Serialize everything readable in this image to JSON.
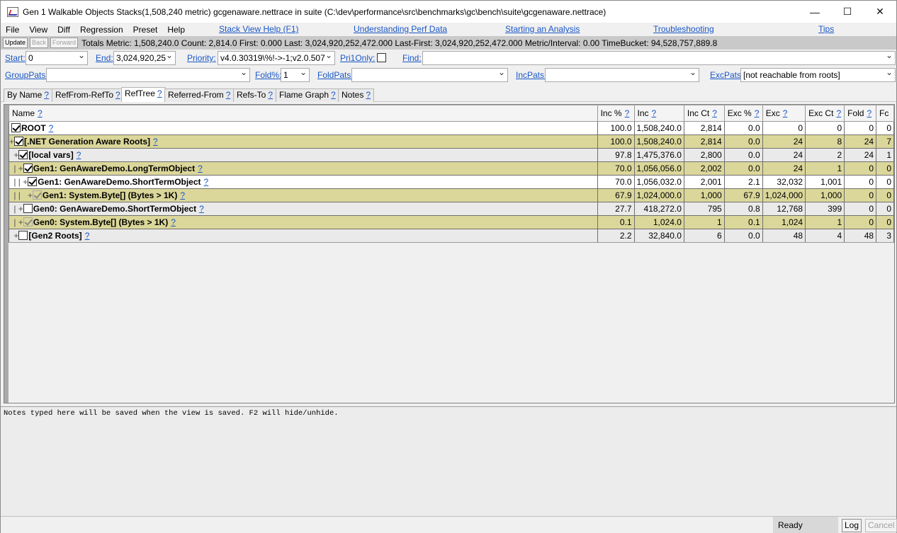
{
  "window": {
    "title": "Gen 1 Walkable Objects Stacks(1,508,240 metric) gcgenaware.nettrace in suite (C:\\dev\\performance\\src\\benchmarks\\gc\\bench\\suite\\gcgenaware.nettrace)",
    "minimize": "—",
    "maximize": "☐",
    "close": "✕"
  },
  "menu": {
    "items": [
      "File",
      "View",
      "Diff",
      "Regression",
      "Preset",
      "Help"
    ],
    "links": [
      "Stack View Help (F1)",
      "Understanding Perf Data",
      "Starting an Analysis",
      "Troubleshooting",
      "Tips"
    ]
  },
  "status": {
    "update": "Update",
    "back": "Back",
    "forward": "Forward",
    "totals": "Totals Metric: 1,508,240.0  Count: 2,814.0  First: 0.000 Last: 3,024,920,252,472.000  Last-First: 3,024,920,252,472.000  Metric/Interval: 0.00  TimeBucket: 94,528,757,889.8"
  },
  "filters": {
    "start_label": "Start:",
    "start_value": "0",
    "end_label": "End:",
    "end_value": "3,024,920,25",
    "priority_label": "Priority:",
    "priority_value": "v4.0.30319\\%!->-1;v2.0.507",
    "pri1only_label": "Pri1Only:",
    "find_label": "Find:",
    "find_value": "",
    "grouppats_label": "GroupPats:",
    "grouppats_value": "",
    "fold_label": "Fold%:",
    "fold_value": "1",
    "foldpats_label": "FoldPats:",
    "foldpats_value": "",
    "incpats_label": "IncPats:",
    "incpats_value": "",
    "excpats_label": "ExcPats:",
    "excpats_value": "[not reachable from roots]"
  },
  "tabs": [
    {
      "label": "By Name"
    },
    {
      "label": "RefFrom-RefTo"
    },
    {
      "label": "RefTree"
    },
    {
      "label": "Referred-From"
    },
    {
      "label": "Refs-To"
    },
    {
      "label": "Flame Graph"
    },
    {
      "label": "Notes"
    }
  ],
  "help_mark": "?",
  "columns": [
    "Name",
    "Inc %",
    "Inc",
    "Inc Ct",
    "Exc %",
    "Exc",
    "Exc Ct",
    "Fold",
    "Fc"
  ],
  "rows": [
    {
      "prefix": "",
      "name": "ROOT",
      "inc_pct": "100.0",
      "inc": "1,508,240.0",
      "inc_ct": "2,814",
      "exc_pct": "0.0",
      "exc": "0",
      "exc_ct": "0",
      "fold": "0",
      "fc": "0"
    },
    {
      "prefix": "+",
      "name": "[.NET Generation Aware Roots]",
      "inc_pct": "100.0",
      "inc": "1,508,240.0",
      "inc_ct": "2,814",
      "exc_pct": "0.0",
      "exc": "24",
      "exc_ct": "8",
      "fold": "24",
      "fc": "7"
    },
    {
      "prefix": " +",
      "name": "[local vars]",
      "inc_pct": "97.8",
      "inc": "1,475,376.0",
      "inc_ct": "2,800",
      "exc_pct": "0.0",
      "exc": "24",
      "exc_ct": "2",
      "fold": "24",
      "fc": "1"
    },
    {
      "prefix": " | +",
      "name": "Gen1: GenAwareDemo.LongTermObject",
      "inc_pct": "70.0",
      "inc": "1,056,056.0",
      "inc_ct": "2,002",
      "exc_pct": "0.0",
      "exc": "24",
      "exc_ct": "1",
      "fold": "0",
      "fc": "0"
    },
    {
      "prefix": " | | +",
      "name": "Gen1: GenAwareDemo.ShortTermObject",
      "inc_pct": "70.0",
      "inc": "1,056,032.0",
      "inc_ct": "2,001",
      "exc_pct": "2.1",
      "exc": "32,032",
      "exc_ct": "1,001",
      "fold": "0",
      "fc": "0"
    },
    {
      "prefix": " | |   +",
      "name": "Gen1: System.Byte[] (Bytes > 1K)",
      "inc_pct": "67.9",
      "inc": "1,024,000.0",
      "inc_ct": "1,000",
      "exc_pct": "67.9",
      "exc": "1,024,000",
      "exc_ct": "1,000",
      "fold": "0",
      "fc": "0"
    },
    {
      "prefix": " | +",
      "name": "Gen0: GenAwareDemo.ShortTermObject",
      "inc_pct": "27.7",
      "inc": "418,272.0",
      "inc_ct": "795",
      "exc_pct": "0.8",
      "exc": "12,768",
      "exc_ct": "399",
      "fold": "0",
      "fc": "0"
    },
    {
      "prefix": " | +",
      "name": "Gen0: System.Byte[] (Bytes > 1K)",
      "inc_pct": "0.1",
      "inc": "1,024.0",
      "inc_ct": "1",
      "exc_pct": "0.1",
      "exc": "1,024",
      "exc_ct": "1",
      "fold": "0",
      "fc": "0"
    },
    {
      "prefix": " +",
      "name": "[Gen2 Roots]",
      "inc_pct": "2.2",
      "inc": "32,840.0",
      "inc_ct": "6",
      "exc_pct": "0.0",
      "exc": "48",
      "exc_ct": "4",
      "fold": "48",
      "fc": "3"
    }
  ],
  "notes": "Notes typed here will be saved when the view is saved. F2 will hide/unhide.",
  "statusbar": {
    "ready": "Ready",
    "log": "Log",
    "cancel": "Cancel"
  }
}
